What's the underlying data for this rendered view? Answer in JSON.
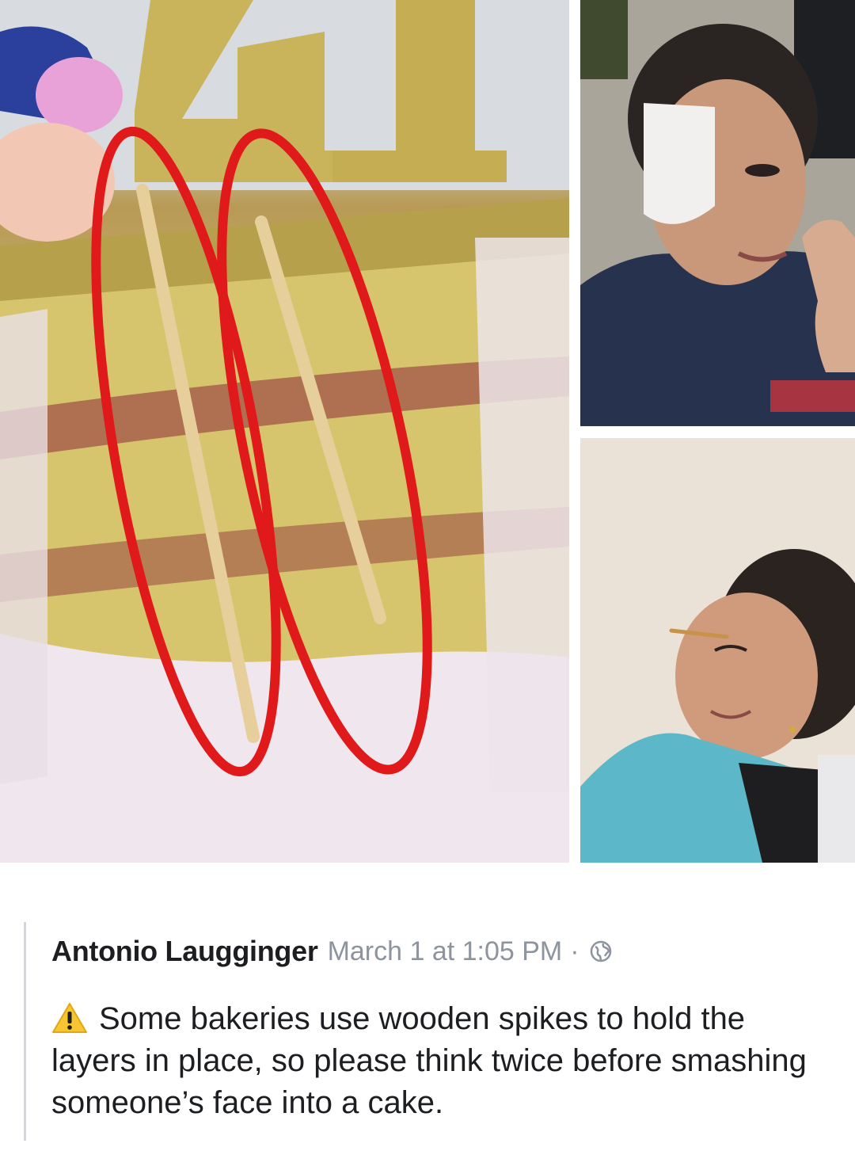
{
  "post": {
    "author": "Antonio Laugginger",
    "date": "March 1 at 1:05 PM",
    "separator": "·",
    "privacy_icon": "globe-icon",
    "warning_icon": "warning-sign-icon",
    "text": "Some bakeries use wooden spikes to hold the layers in place, so please think twice before smashing someone’s face into a cake."
  },
  "photos": {
    "cake_topper": "41"
  },
  "colors": {
    "annotation_red": "#e0191b",
    "author_text": "#1c1e21",
    "meta_text": "#8d949e",
    "warning_yellow": "#f7c531"
  }
}
